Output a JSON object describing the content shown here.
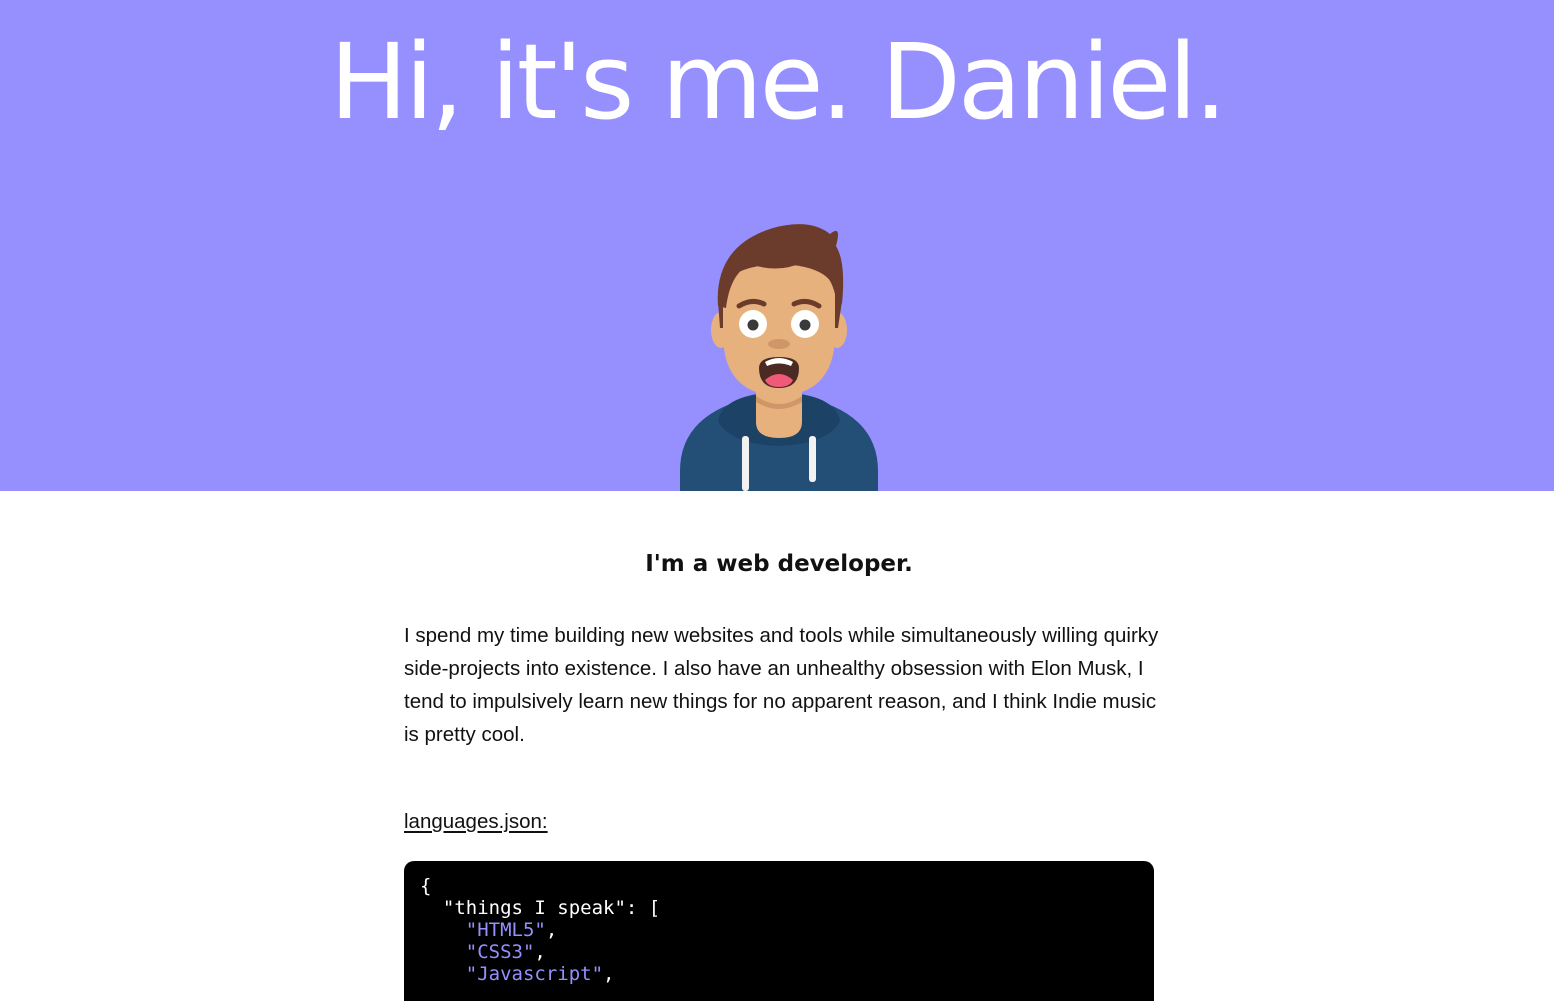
{
  "hero": {
    "title": "Hi, it's me. Daniel.",
    "background_color": "#9690ff",
    "avatar_icon": "cartoon-avatar-icon"
  },
  "intro": {
    "tagline": "I'm a web developer.",
    "bio": "I spend my time building new websites and tools while simultaneously willing quirky side-projects into existence. I also have an unhealthy obsession with Elon Musk, I tend to impulsively learn new things for no apparent reason, and I think Indie music is pretty cool."
  },
  "languages_file": {
    "link_label": "languages.json:",
    "open_brace": "{",
    "key": "\"things I speak\"",
    "key_suffix": ": [",
    "items": [
      "\"HTML5\"",
      "\"CSS3\"",
      "\"Javascript\""
    ],
    "item_separator": ",",
    "string_color": "#9690ff"
  }
}
